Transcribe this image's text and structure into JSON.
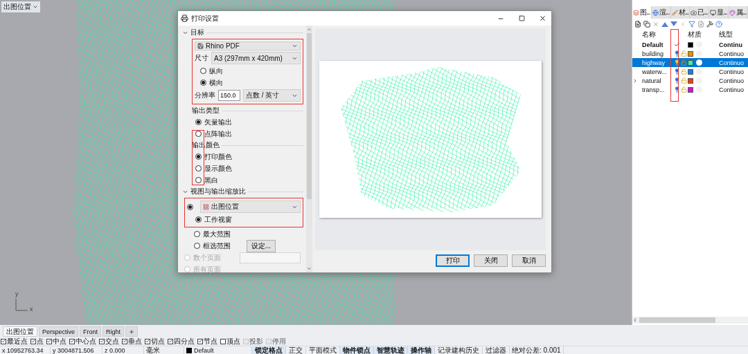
{
  "viewport": {
    "title": "出图位置",
    "axis_y": "y",
    "axis_x": "x"
  },
  "dialog": {
    "title": "打印设置",
    "target": {
      "heading": "目标",
      "expanded": true,
      "printer": "Rhino PDF",
      "size_label": "尺寸",
      "size": "A3 (297mm x 420mm)",
      "orientation": [
        {
          "label": "纵向",
          "selected": false
        },
        {
          "label": "横向",
          "selected": true
        }
      ],
      "resolution_label": "分辨率",
      "resolution": "150.0",
      "resolution_unit": "点数 / 英寸"
    },
    "output_type": {
      "heading": "输出类型",
      "options": [
        {
          "label": "矢量输出",
          "selected": true
        },
        {
          "label": "点阵输出",
          "selected": false
        }
      ]
    },
    "output_color": {
      "heading": "输出颜色",
      "options": [
        {
          "label": "打印颜色",
          "selected": true
        },
        {
          "label": "显示颜色",
          "selected": false
        },
        {
          "label": "黑白",
          "selected": false
        }
      ]
    },
    "view": {
      "heading": "视图与输出缩放比",
      "expanded": true,
      "selected": true,
      "view_name": "出图位置",
      "options": [
        {
          "kind": "plain",
          "label": "工作视窗",
          "selected": true,
          "disabled": false
        },
        {
          "kind": "plain",
          "label": "最大范围",
          "selected": false,
          "disabled": false
        },
        {
          "kind": "button",
          "label": "框选范围",
          "selected": false,
          "disabled": false,
          "button": "设定..."
        },
        {
          "kind": "field",
          "label": "数个页面",
          "selected": false,
          "disabled": true
        },
        {
          "kind": "plain",
          "label": "所有页面",
          "selected": false,
          "disabled": true
        }
      ]
    },
    "buttons": [
      {
        "label": "打印",
        "default": true
      },
      {
        "label": "关闭",
        "default": false
      },
      {
        "label": "取消",
        "default": false
      }
    ]
  },
  "layers_panel": {
    "tabs": [
      {
        "label": "图...",
        "selected": true
      },
      {
        "label": "渲...",
        "selected": false
      },
      {
        "label": "材...",
        "selected": false
      },
      {
        "label": "已...",
        "selected": false
      },
      {
        "label": "显...",
        "selected": false
      },
      {
        "label": "属...",
        "selected": false
      }
    ],
    "columns": {
      "name": "名称",
      "material": "材质",
      "linetype": "线型"
    },
    "layers": [
      {
        "name": "Default",
        "current": true,
        "selected": false,
        "expandable": false,
        "color": "#000000",
        "linetype": "Continu"
      },
      {
        "name": "building",
        "current": false,
        "selected": false,
        "expandable": false,
        "color": "#f08c00",
        "linetype": "Continuo"
      },
      {
        "name": "highway",
        "current": false,
        "selected": true,
        "expandable": false,
        "color": "#33f0b0",
        "linetype": "Continuo"
      },
      {
        "name": "waterw...",
        "current": false,
        "selected": false,
        "expandable": false,
        "color": "#1e78f0",
        "linetype": "Continuo"
      },
      {
        "name": "natural",
        "current": false,
        "selected": false,
        "expandable": true,
        "color": "#f04010",
        "linetype": "Continuo"
      },
      {
        "name": "transp...",
        "current": false,
        "selected": false,
        "expandable": false,
        "color": "#d010e0",
        "linetype": "Continuo"
      }
    ]
  },
  "view_tabs": [
    {
      "label": "出图位置",
      "selected": true
    },
    {
      "label": "Perspective",
      "selected": false
    },
    {
      "label": "Front",
      "selected": false
    },
    {
      "label": "Right",
      "selected": false
    }
  ],
  "osnaps": [
    {
      "label": "最近点",
      "checked": true,
      "disabled": false
    },
    {
      "label": "点",
      "checked": true,
      "disabled": false
    },
    {
      "label": "中点",
      "checked": true,
      "disabled": false
    },
    {
      "label": "中心点",
      "checked": true,
      "disabled": false
    },
    {
      "label": "交点",
      "checked": true,
      "disabled": false
    },
    {
      "label": "垂点",
      "checked": true,
      "disabled": false
    },
    {
      "label": "切点",
      "checked": true,
      "disabled": false
    },
    {
      "label": "四分点",
      "checked": true,
      "disabled": false
    },
    {
      "label": "节点",
      "checked": true,
      "disabled": false
    },
    {
      "label": "顶点",
      "checked": false,
      "disabled": false
    },
    {
      "label": "投影",
      "checked": false,
      "disabled": true
    },
    {
      "label": "停用",
      "checked": false,
      "disabled": true
    }
  ],
  "status_bar": {
    "x": "x 10952763.34",
    "y": "y 3004871.506",
    "z": "z 0.000",
    "units": "毫米",
    "layer": "Default",
    "toggles": [
      {
        "label": "锁定格点",
        "on": true
      },
      {
        "label": "正交",
        "on": false
      },
      {
        "label": "平面模式",
        "on": false
      },
      {
        "label": "物件锁点",
        "on": true
      },
      {
        "label": "智慧轨迹",
        "on": true
      },
      {
        "label": "操作轴",
        "on": true
      },
      {
        "label": "记录建构历史",
        "on": false
      },
      {
        "label": "过滤器",
        "on": false
      }
    ],
    "tolerance": "绝对公差: 0.001"
  }
}
